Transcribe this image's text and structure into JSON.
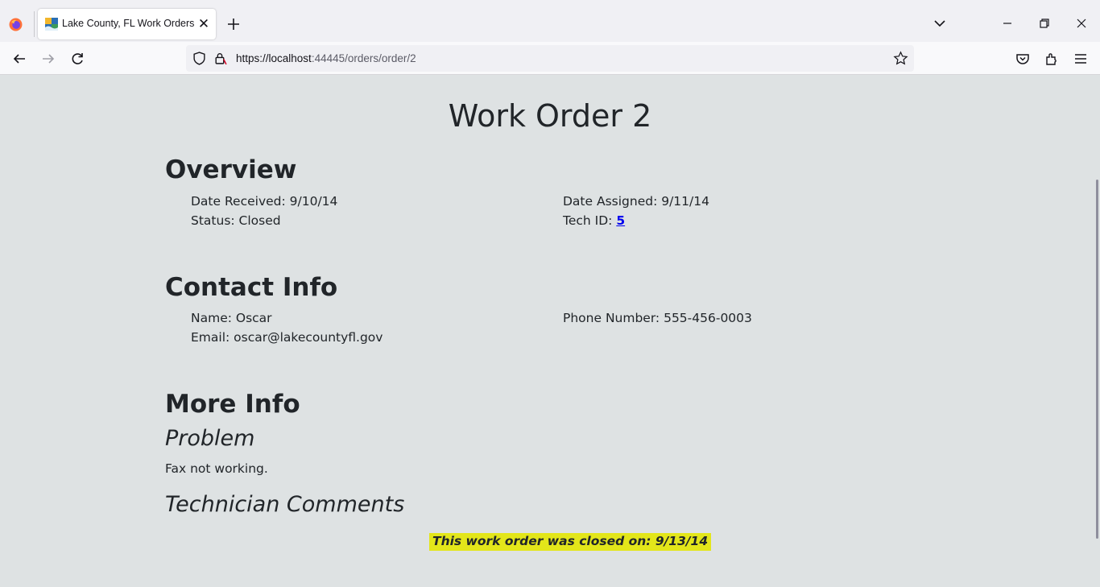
{
  "browser": {
    "tab_title": "Lake County, FL Work Orders",
    "url_host": "https://localhost",
    "url_rest": ":44445/orders/order/2"
  },
  "page": {
    "title": "Work Order 2",
    "overview": {
      "heading": "Overview",
      "date_received": "Date Received: 9/10/14",
      "date_assigned": "Date Assigned: 9/11/14",
      "status": "Status: Closed",
      "tech_id_label": "Tech ID: ",
      "tech_id_value": "5"
    },
    "contact": {
      "heading": "Contact Info",
      "name": "Name: Oscar",
      "phone": "Phone Number: 555-456-0003",
      "email": "Email: oscar@lakecountyfl.gov"
    },
    "more_info": {
      "heading": "More Info",
      "problem_heading": "Problem",
      "problem_text": "Fax not working.",
      "comments_heading": "Technician Comments"
    },
    "closed_note": "This work order was closed on: 9/13/14"
  },
  "colors": {
    "page_bg": "#dee2e3",
    "highlight": "#e3e61a",
    "link": "#0000ee"
  }
}
